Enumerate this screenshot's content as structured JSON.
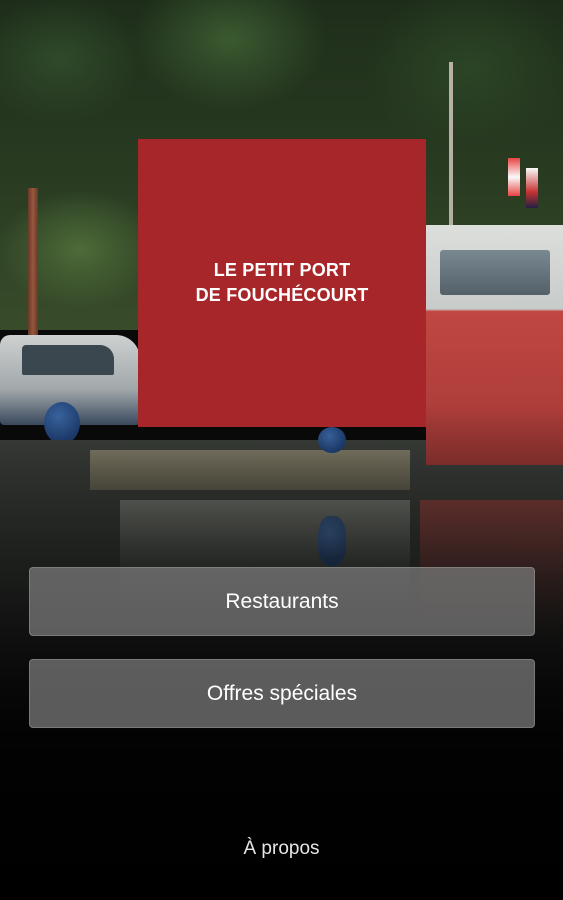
{
  "logo": {
    "line1": "LE PETIT PORT",
    "line2": "DE FOUCHÉCOURT",
    "background_color": "#a6262a"
  },
  "buttons": {
    "restaurants": "Restaurants",
    "offres_speciales": "Offres spéciales"
  },
  "footer": {
    "about": "À propos"
  }
}
